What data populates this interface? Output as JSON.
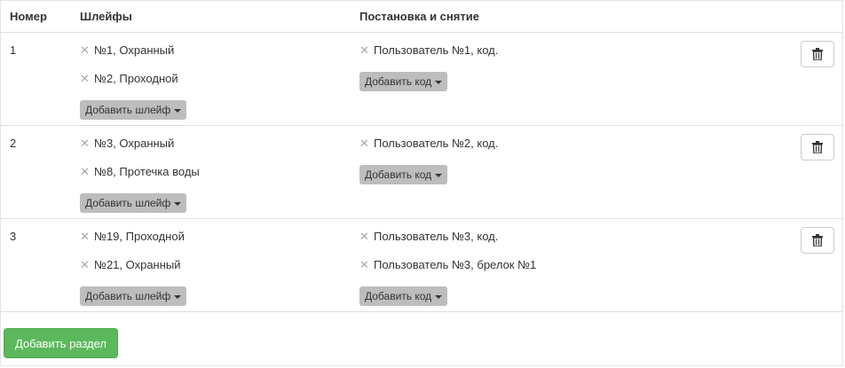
{
  "table": {
    "headers": {
      "number": "Номер",
      "loops": "Шлейфы",
      "arming": "Постановка и снятие"
    },
    "remove_glyph": "✕",
    "add_loop_label": "Добавить шлейф",
    "add_code_label": "Добавить код",
    "rows": [
      {
        "number": "1",
        "loops": [
          "№1, Охранный",
          "№2, Проходной"
        ],
        "codes": [
          "Пользователь №1, код."
        ]
      },
      {
        "number": "2",
        "loops": [
          "№3, Охранный",
          "№8, Протечка воды"
        ],
        "codes": [
          "Пользователь №2, код."
        ]
      },
      {
        "number": "3",
        "loops": [
          "№19, Проходной",
          "№21, Охранный"
        ],
        "codes": [
          "Пользователь №3, код.",
          "Пользователь №3, брелок №1"
        ]
      }
    ]
  },
  "add_section_label": "Добавить раздел",
  "icons": {
    "remove": "close-icon",
    "delete": "trash-icon",
    "dropdown": "caret-down-icon"
  },
  "colors": {
    "add_section_bg": "#5cb85c",
    "dropdown_bg": "#bdbdbd",
    "remove_icon": "#aaaaaa"
  }
}
